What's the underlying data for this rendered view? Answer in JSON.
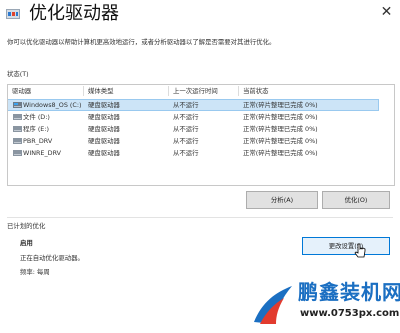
{
  "window": {
    "title": "优化驱动器",
    "close_glyph": "✕"
  },
  "description": "你可以优化驱动器以帮助计算机更高效地运行，或者分析驱动器以了解是否需要对其进行优化。",
  "status_section": {
    "label": "状态(T)",
    "columns": [
      "驱动器",
      "媒体类型",
      "上一次运行时间",
      "当前状态"
    ],
    "rows": [
      {
        "drive": "Windows8_OS (C:)",
        "media": "硬盘驱动器",
        "last_run": "从不运行",
        "status": "正常(碎片整理已完成 0%)",
        "selected": true
      },
      {
        "drive": "文件 (D:)",
        "media": "硬盘驱动器",
        "last_run": "从不运行",
        "status": "正常(碎片整理已完成 0%)",
        "selected": false
      },
      {
        "drive": "程序 (E:)",
        "media": "硬盘驱动器",
        "last_run": "从不运行",
        "status": "正常(碎片整理已完成 0%)",
        "selected": false
      },
      {
        "drive": "PBR_DRV",
        "media": "硬盘驱动器",
        "last_run": "从不运行",
        "status": "正常(碎片整理已完成 0%)",
        "selected": false
      },
      {
        "drive": "WINRE_DRV",
        "media": "硬盘驱动器",
        "last_run": "从不运行",
        "status": "正常(碎片整理已完成 0%)",
        "selected": false
      }
    ]
  },
  "buttons": {
    "analyze": "分析(A)",
    "optimize": "优化(O)",
    "change_settings": "更改设置(S)"
  },
  "scheduled": {
    "label": "已计划的优化",
    "state": "启用",
    "detail": "正在自动优化驱动器。",
    "frequency": "频率: 每周"
  },
  "watermark": {
    "brand": "鹏鑫装机网",
    "url": "www.0753px.com"
  },
  "colors": {
    "selection": "#cce4f7",
    "accent": "#0078d7",
    "brand": "#1b6fc2"
  }
}
